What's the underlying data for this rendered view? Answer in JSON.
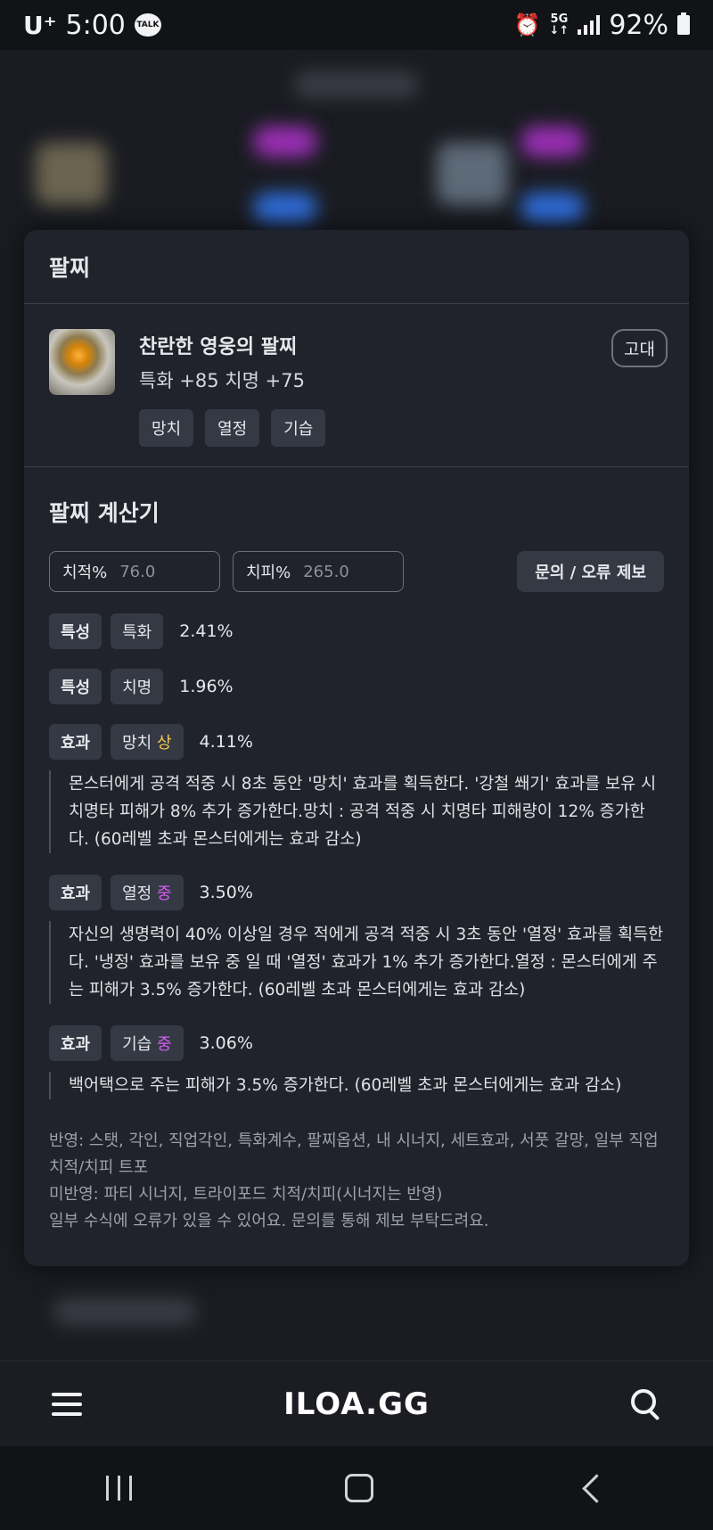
{
  "status_bar": {
    "carrier": "U⁺",
    "time": "5:00",
    "talk_badge": "TALK",
    "network_top": "5G",
    "network_bottom": "↓↑",
    "battery": "92%"
  },
  "modal": {
    "header_title": "팔찌",
    "item": {
      "name": "찬란한 영웅의 팔찌",
      "stats": "특화 +85   치명 +75",
      "grade": "고대",
      "chips": [
        "망치",
        "열정",
        "기습"
      ]
    },
    "calculator": {
      "title": "팔찌 계산기",
      "crit_rate_label": "치적%",
      "crit_rate_value": "76.0",
      "crit_dmg_label": "치피%",
      "crit_dmg_value": "265.0",
      "report_button": "문의 / 오류 제보",
      "rows": [
        {
          "kind": "특성",
          "name": "특화",
          "grade": "",
          "pct": "2.41%"
        },
        {
          "kind": "특성",
          "name": "치명",
          "grade": "",
          "pct": "1.96%"
        },
        {
          "kind": "효과",
          "name": "망치",
          "grade": "상",
          "pct": "4.11%",
          "desc": "몬스터에게 공격 적중 시 8초 동안 '망치' 효과를 획득한다. '강철 쐐기' 효과를 보유 시 치명타 피해가 8% 추가 증가한다.망치 : 공격 적중 시 치명타 피해량이 12% 증가한다. (60레벨 초과 몬스터에게는 효과 감소)"
        },
        {
          "kind": "효과",
          "name": "열정",
          "grade": "중",
          "pct": "3.50%",
          "desc": "자신의 생명력이 40% 이상일 경우 적에게 공격 적중 시 3초 동안 '열정' 효과를 획득한다. '냉정' 효과를 보유 중 일 때 '열정' 효과가 1% 추가 증가한다.열정 : 몬스터에게 주는 피해가 3.5% 증가한다. (60레벨 초과 몬스터에게는 효과 감소)"
        },
        {
          "kind": "효과",
          "name": "기습",
          "grade": "중",
          "pct": "3.06%",
          "desc": "백어택으로 주는 피해가 3.5% 증가한다. (60레벨 초과 몬스터에게는 효과 감소)"
        }
      ],
      "notes": [
        "반영: 스탯, 각인, 직업각인, 특화계수, 팔찌옵션, 내 시너지, 세트효과, 서풋 갈망, 일부 직업 치적/치피 트포",
        "미반영: 파티 시너지, 트라이포드 치적/치피(시너지는 반영)",
        "일부 수식에 오류가 있을 수 있어요. 문의를 통해 제보 부탁드려요."
      ]
    }
  },
  "bottom_bar": {
    "logo": "ILOA.GG"
  },
  "colors": {
    "grade_high": "#f2c94c",
    "grade_mid": "#d65df2",
    "modal_bg": "#20232b"
  }
}
